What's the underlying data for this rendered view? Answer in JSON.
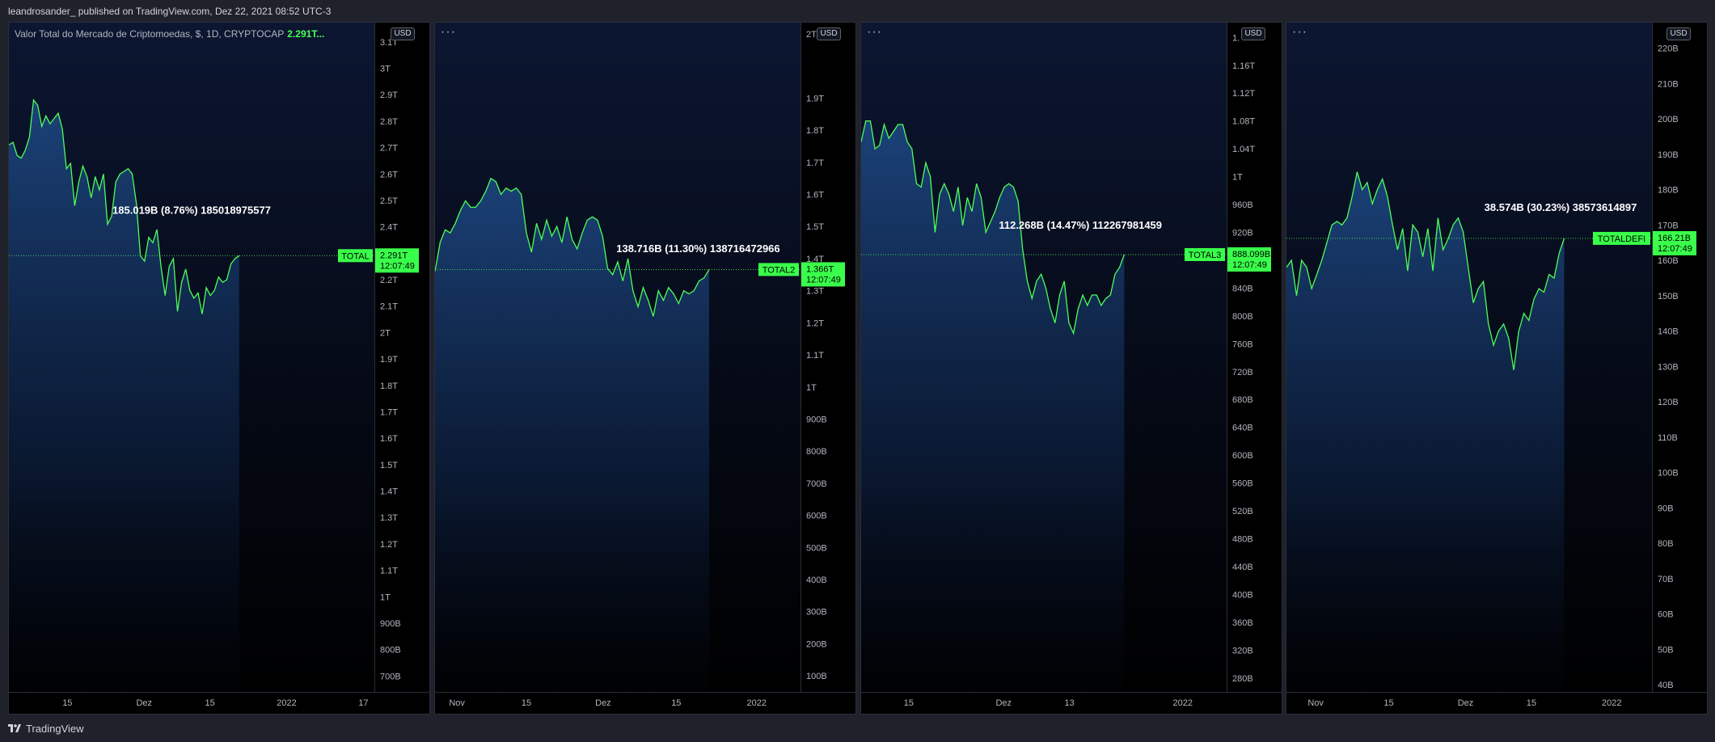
{
  "header": {
    "text": "leandrosander_ published on TradingView.com, Dez 22, 2021 08:52 UTC-3"
  },
  "footer": {
    "brand": "TradingView"
  },
  "colors": {
    "line": "#4cff5a",
    "label_bg": "#39ff4a",
    "bg": "#000000"
  },
  "chart_data": [
    {
      "type": "area",
      "legend": "Valor Total do Mercado de Criptomoedas, $, 1D, CRYPTOCAP",
      "legend_value": "2.291T...",
      "currency_button": "USD",
      "ticker": "TOTAL",
      "last_price": "2.291T",
      "countdown": "12:07:49",
      "last_value": 2.291,
      "ylim": [
        0.64,
        3.13
      ],
      "y_ticks": [
        {
          "v": 3.1,
          "label": "3.1T"
        },
        {
          "v": 3.0,
          "label": "3T"
        },
        {
          "v": 2.9,
          "label": "2.9T"
        },
        {
          "v": 2.8,
          "label": "2.8T"
        },
        {
          "v": 2.7,
          "label": "2.7T"
        },
        {
          "v": 2.6,
          "label": "2.6T"
        },
        {
          "v": 2.5,
          "label": "2.5T"
        },
        {
          "v": 2.4,
          "label": "2.4T"
        },
        {
          "v": 2.2,
          "label": "2.2T"
        },
        {
          "v": 2.1,
          "label": "2.1T"
        },
        {
          "v": 2.0,
          "label": "2T"
        },
        {
          "v": 1.9,
          "label": "1.9T"
        },
        {
          "v": 1.8,
          "label": "1.8T"
        },
        {
          "v": 1.7,
          "label": "1.7T"
        },
        {
          "v": 1.6,
          "label": "1.6T"
        },
        {
          "v": 1.5,
          "label": "1.5T"
        },
        {
          "v": 1.4,
          "label": "1.4T"
        },
        {
          "v": 1.3,
          "label": "1.3T"
        },
        {
          "v": 1.2,
          "label": "1.2T"
        },
        {
          "v": 1.1,
          "label": "1.1T"
        },
        {
          "v": 1.0,
          "label": "1T"
        },
        {
          "v": 0.9,
          "label": "900B"
        },
        {
          "v": 0.8,
          "label": "800B"
        },
        {
          "v": 0.7,
          "label": "700B"
        }
      ],
      "x_ticks": [
        {
          "pos": 0.16,
          "label": "15"
        },
        {
          "pos": 0.37,
          "label": "Dez"
        },
        {
          "pos": 0.55,
          "label": "15"
        },
        {
          "pos": 0.76,
          "label": "2022"
        },
        {
          "pos": 0.97,
          "label": "17"
        }
      ],
      "data_end": 0.63,
      "annotation": "185.019B (8.76%) 185018975577",
      "annotation_value": 2.45,
      "annotation_pos": 0.5,
      "values": [
        2.71,
        2.72,
        2.67,
        2.66,
        2.69,
        2.74,
        2.88,
        2.86,
        2.78,
        2.82,
        2.79,
        2.81,
        2.83,
        2.77,
        2.62,
        2.64,
        2.48,
        2.57,
        2.63,
        2.59,
        2.51,
        2.59,
        2.54,
        2.6,
        2.41,
        2.44,
        2.57,
        2.6,
        2.61,
        2.62,
        2.6,
        2.49,
        2.29,
        2.27,
        2.36,
        2.34,
        2.39,
        2.25,
        2.14,
        2.25,
        2.28,
        2.08,
        2.19,
        2.24,
        2.16,
        2.13,
        2.15,
        2.07,
        2.17,
        2.14,
        2.16,
        2.21,
        2.19,
        2.2,
        2.26,
        2.28,
        2.291
      ]
    },
    {
      "type": "area",
      "currency_button": "USD",
      "ticker": "TOTAL2",
      "last_price": "1.366T",
      "countdown": "12:07:49",
      "last_value": 1.366,
      "ylim": [
        0.05,
        2.1
      ],
      "y_ticks": [
        {
          "v": 2.1,
          "label": "2T"
        },
        {
          "v": 1.9,
          "label": "1.9T"
        },
        {
          "v": 1.8,
          "label": "1.8T"
        },
        {
          "v": 1.7,
          "label": "1.7T"
        },
        {
          "v": 1.6,
          "label": "1.6T"
        },
        {
          "v": 1.5,
          "label": "1.5T"
        },
        {
          "v": 1.4,
          "label": "1.4T"
        },
        {
          "v": 1.3,
          "label": "1.3T"
        },
        {
          "v": 1.2,
          "label": "1.2T"
        },
        {
          "v": 1.1,
          "label": "1.1T"
        },
        {
          "v": 1.0,
          "label": "1T"
        },
        {
          "v": 0.9,
          "label": "900B"
        },
        {
          "v": 0.8,
          "label": "800B"
        },
        {
          "v": 0.7,
          "label": "700B"
        },
        {
          "v": 0.6,
          "label": "600B"
        },
        {
          "v": 0.5,
          "label": "500B"
        },
        {
          "v": 0.4,
          "label": "400B"
        },
        {
          "v": 0.3,
          "label": "300B"
        },
        {
          "v": 0.2,
          "label": "200B"
        },
        {
          "v": 0.1,
          "label": "100B"
        }
      ],
      "x_ticks": [
        {
          "pos": 0.06,
          "label": "Nov"
        },
        {
          "pos": 0.25,
          "label": "15"
        },
        {
          "pos": 0.46,
          "label": "Dez"
        },
        {
          "pos": 0.66,
          "label": "15"
        },
        {
          "pos": 0.88,
          "label": "2022"
        }
      ],
      "data_end": 0.75,
      "annotation": "138.716B (11.30%) 138716472966",
      "annotation_value": 1.42,
      "annotation_pos": 0.72,
      "values": [
        1.36,
        1.45,
        1.49,
        1.48,
        1.51,
        1.55,
        1.58,
        1.56,
        1.56,
        1.58,
        1.61,
        1.65,
        1.64,
        1.6,
        1.62,
        1.61,
        1.62,
        1.6,
        1.48,
        1.42,
        1.51,
        1.46,
        1.52,
        1.47,
        1.5,
        1.45,
        1.53,
        1.46,
        1.43,
        1.48,
        1.52,
        1.53,
        1.52,
        1.47,
        1.37,
        1.35,
        1.39,
        1.33,
        1.4,
        1.3,
        1.25,
        1.31,
        1.27,
        1.22,
        1.3,
        1.27,
        1.31,
        1.29,
        1.26,
        1.3,
        1.29,
        1.3,
        1.33,
        1.34,
        1.366
      ]
    },
    {
      "type": "area",
      "currency_button": "USD",
      "ticker": "TOTAL3",
      "last_price": "888.099B",
      "countdown": "12:07:49",
      "last_value": 888.099,
      "ylim": [
        260,
        1205
      ],
      "y_ticks": [
        {
          "v": 1200,
          "label": "1."
        },
        {
          "v": 1160,
          "label": "1.16T"
        },
        {
          "v": 1120,
          "label": "1.12T"
        },
        {
          "v": 1080,
          "label": "1.08T"
        },
        {
          "v": 1040,
          "label": "1.04T"
        },
        {
          "v": 1000,
          "label": "1T"
        },
        {
          "v": 960,
          "label": "960B"
        },
        {
          "v": 920,
          "label": "920B"
        },
        {
          "v": 840,
          "label": "840B"
        },
        {
          "v": 800,
          "label": "800B"
        },
        {
          "v": 760,
          "label": "760B"
        },
        {
          "v": 720,
          "label": "720B"
        },
        {
          "v": 680,
          "label": "680B"
        },
        {
          "v": 640,
          "label": "640B"
        },
        {
          "v": 600,
          "label": "600B"
        },
        {
          "v": 560,
          "label": "560B"
        },
        {
          "v": 520,
          "label": "520B"
        },
        {
          "v": 480,
          "label": "480B"
        },
        {
          "v": 440,
          "label": "440B"
        },
        {
          "v": 400,
          "label": "400B"
        },
        {
          "v": 360,
          "label": "360B"
        },
        {
          "v": 320,
          "label": "320B"
        },
        {
          "v": 280,
          "label": "280B"
        }
      ],
      "x_ticks": [
        {
          "pos": 0.13,
          "label": "15"
        },
        {
          "pos": 0.39,
          "label": "Dez"
        },
        {
          "pos": 0.57,
          "label": "13"
        },
        {
          "pos": 0.88,
          "label": "2022"
        }
      ],
      "data_end": 0.72,
      "annotation": "112.268B (14.47%) 112267981459",
      "annotation_value": 925,
      "annotation_pos": 0.6,
      "values": [
        1050,
        1080,
        1080,
        1040,
        1045,
        1075,
        1055,
        1065,
        1075,
        1075,
        1050,
        1040,
        990,
        985,
        1020,
        1000,
        920,
        975,
        990,
        975,
        950,
        985,
        930,
        970,
        950,
        990,
        970,
        920,
        935,
        950,
        970,
        985,
        990,
        985,
        965,
        895,
        850,
        825,
        850,
        860,
        840,
        810,
        790,
        830,
        850,
        790,
        775,
        810,
        830,
        815,
        830,
        830,
        815,
        825,
        830,
        860,
        870,
        888.1
      ]
    },
    {
      "type": "area",
      "currency_button": "USD",
      "ticker": "TOTALDEFI",
      "last_price": "166.21B",
      "countdown": "12:07:49",
      "last_value": 166.21,
      "ylim": [
        38,
        224
      ],
      "y_ticks": [
        {
          "v": 220,
          "label": "220B"
        },
        {
          "v": 210,
          "label": "210B"
        },
        {
          "v": 200,
          "label": "200B"
        },
        {
          "v": 190,
          "label": "190B"
        },
        {
          "v": 180,
          "label": "180B"
        },
        {
          "v": 170,
          "label": "170B"
        },
        {
          "v": 160,
          "label": "160B"
        },
        {
          "v": 150,
          "label": "150B"
        },
        {
          "v": 140,
          "label": "140B"
        },
        {
          "v": 130,
          "label": "130B"
        },
        {
          "v": 120,
          "label": "120B"
        },
        {
          "v": 110,
          "label": "110B"
        },
        {
          "v": 100,
          "label": "100B"
        },
        {
          "v": 90,
          "label": "90B"
        },
        {
          "v": 80,
          "label": "80B"
        },
        {
          "v": 70,
          "label": "70B"
        },
        {
          "v": 60,
          "label": "60B"
        },
        {
          "v": 50,
          "label": "50B"
        },
        {
          "v": 40,
          "label": "40B"
        }
      ],
      "x_ticks": [
        {
          "pos": 0.08,
          "label": "Nov"
        },
        {
          "pos": 0.28,
          "label": "15"
        },
        {
          "pos": 0.49,
          "label": "Dez"
        },
        {
          "pos": 0.67,
          "label": "15"
        },
        {
          "pos": 0.89,
          "label": "2022"
        }
      ],
      "data_end": 0.76,
      "annotation": "38.574B (30.23%) 38573614897",
      "annotation_value": 174,
      "annotation_pos": 0.75,
      "values": [
        158,
        160,
        150,
        160,
        158,
        152,
        156,
        160,
        165,
        170,
        171,
        170,
        172,
        178,
        185,
        180,
        182,
        176,
        180,
        183,
        178,
        170,
        163,
        169,
        157,
        170,
        168,
        161,
        169,
        157,
        172,
        163,
        166,
        170,
        172,
        168,
        158,
        148,
        152,
        154,
        142,
        136,
        140,
        142,
        138,
        129,
        140,
        145,
        143,
        149,
        152,
        151,
        156,
        155,
        162,
        166.2
      ]
    }
  ]
}
